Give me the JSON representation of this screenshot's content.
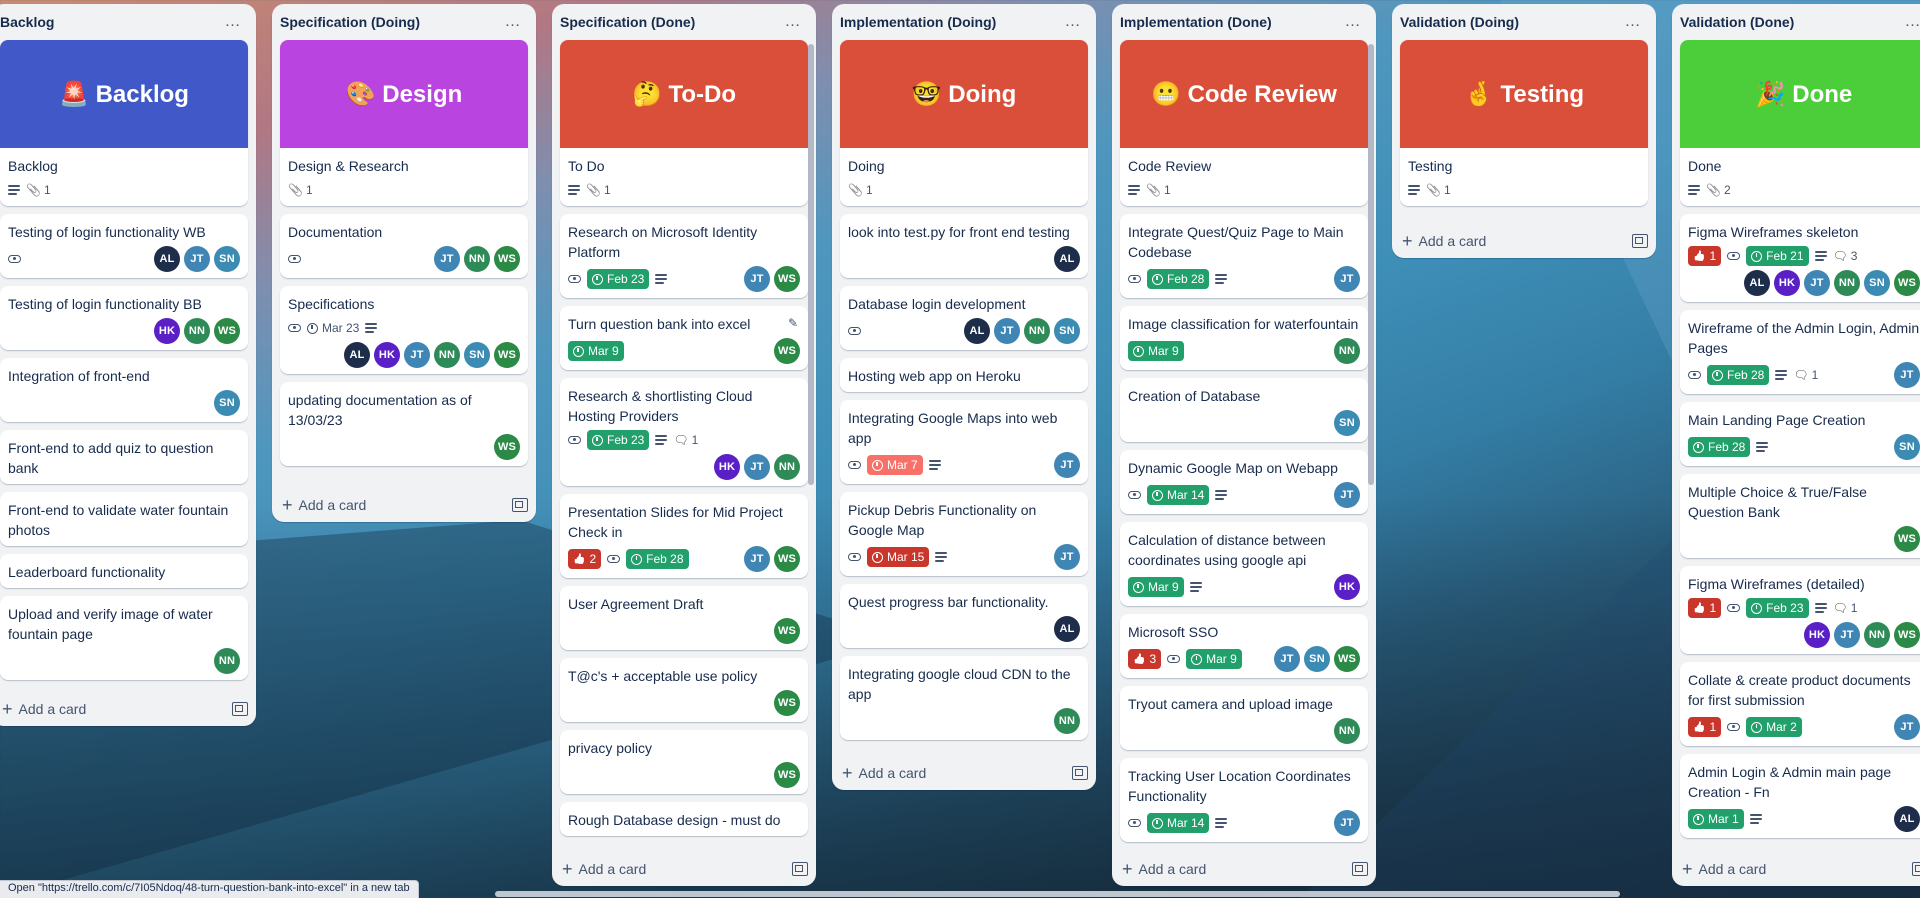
{
  "status_bar": "Open \"https://trello.com/c/7I05Ndoq/48-turn-question-bank-into-excel\" in a new tab",
  "add_card_label": "Add a card",
  "colors": {
    "AL": "#1d2d4a",
    "HK": "#5b1fc6",
    "JT": "#3f86b5",
    "NN": "#2e8b57",
    "SN": "#3b8bb3",
    "WS": "#2b8a45"
  },
  "lists": [
    {
      "title": "Backlog",
      "cards": [
        {
          "cover_color": "#4159c8",
          "cover_text": "🚨 Backlog",
          "title": "Backlog",
          "badges": [
            {
              "type": "desc"
            },
            {
              "type": "attach",
              "text": "1"
            }
          ]
        },
        {
          "title": "Testing of login functionality WB",
          "badges": [
            {
              "type": "watch"
            }
          ],
          "members": [
            "AL",
            "JT",
            "SN"
          ],
          "members_inline": true
        },
        {
          "title": "Testing of login functionality BB",
          "members": [
            "HK",
            "NN",
            "WS"
          ]
        },
        {
          "title": "Integration of front-end",
          "members": [
            "SN"
          ]
        },
        {
          "title": "Front-end to add quiz to question bank"
        },
        {
          "title": "Front-end to validate water fountain photos"
        },
        {
          "title": "Leaderboard functionality"
        },
        {
          "title": "Upload and verify image of water fountain page",
          "members": [
            "NN"
          ]
        }
      ]
    },
    {
      "title": "Specification (Doing)",
      "cards": [
        {
          "cover_color": "#b944e0",
          "cover_text": "🎨 Design",
          "title": "Design & Research",
          "badges": [
            {
              "type": "attach",
              "text": "1"
            }
          ]
        },
        {
          "title": "Documentation",
          "badges": [
            {
              "type": "watch"
            }
          ],
          "members": [
            "JT",
            "NN",
            "WS"
          ],
          "members_inline": true
        },
        {
          "title": "Specifications",
          "badges": [
            {
              "type": "watch"
            },
            {
              "type": "date",
              "style": "plain",
              "text": "Mar 23"
            },
            {
              "type": "desc"
            }
          ],
          "members": [
            "AL",
            "HK",
            "JT",
            "NN",
            "SN",
            "WS"
          ]
        },
        {
          "title": "updating documentation as of 13/03/23",
          "members": [
            "WS"
          ]
        }
      ]
    },
    {
      "title": "Specification (Done)",
      "cards": [
        {
          "cover_color": "#da4f39",
          "cover_text": "🤔 To-Do",
          "title": "To Do",
          "badges": [
            {
              "type": "desc"
            },
            {
              "type": "attach",
              "text": "1"
            }
          ]
        },
        {
          "title": "Research on Microsoft Identity Platform",
          "badges": [
            {
              "type": "watch"
            },
            {
              "type": "date",
              "style": "green",
              "text": "Feb 23"
            },
            {
              "type": "desc"
            }
          ],
          "members": [
            "JT",
            "WS"
          ],
          "members_inline": true
        },
        {
          "title": "Turn question bank into excel",
          "badges": [
            {
              "type": "date",
              "style": "green",
              "text": "Mar 9"
            }
          ],
          "members": [
            "WS"
          ],
          "members_inline": true,
          "pencil": "✎"
        },
        {
          "title": "Research & shortlisting Cloud Hosting Providers",
          "badges": [
            {
              "type": "watch"
            },
            {
              "type": "date",
              "style": "green",
              "text": "Feb 23"
            },
            {
              "type": "desc"
            },
            {
              "type": "comment",
              "text": "1"
            }
          ],
          "members": [
            "HK",
            "JT",
            "NN"
          ]
        },
        {
          "title": "Presentation Slides for Mid Project Check in",
          "badges": [
            {
              "type": "votes",
              "text": "2"
            },
            {
              "type": "watch"
            },
            {
              "type": "date",
              "style": "green",
              "text": "Feb 28"
            }
          ],
          "members": [
            "JT",
            "WS"
          ],
          "members_inline": true
        },
        {
          "title": "User Agreement Draft",
          "members": [
            "WS"
          ]
        },
        {
          "title": "T@c's + acceptable use policy",
          "members": [
            "WS"
          ]
        },
        {
          "title": "privacy policy",
          "members": [
            "WS"
          ]
        },
        {
          "title": "Rough Database design - must do"
        }
      ],
      "scrollbar": true
    },
    {
      "title": "Implementation (Doing)",
      "cards": [
        {
          "cover_color": "#da4f39",
          "cover_text": "🤓 Doing",
          "title": "Doing",
          "badges": [
            {
              "type": "attach",
              "text": "1"
            }
          ]
        },
        {
          "title": "look into test.py for front end testing",
          "members": [
            "AL"
          ]
        },
        {
          "title": "Database login development",
          "badges": [
            {
              "type": "watch"
            }
          ],
          "members": [
            "AL",
            "JT",
            "NN",
            "SN"
          ],
          "members_inline": true
        },
        {
          "title": "Hosting web app on Heroku"
        },
        {
          "title": "Integrating Google Maps into web app",
          "badges": [
            {
              "type": "watch"
            },
            {
              "type": "date",
              "style": "lightred",
              "text": "Mar 7"
            },
            {
              "type": "desc"
            }
          ],
          "members": [
            "JT"
          ],
          "members_inline": true
        },
        {
          "title": "Pickup Debris Functionality on Google Map",
          "badges": [
            {
              "type": "watch"
            },
            {
              "type": "date",
              "style": "red",
              "text": "Mar 15"
            },
            {
              "type": "desc"
            }
          ],
          "members": [
            "JT"
          ],
          "members_inline": true
        },
        {
          "title": "Quest progress bar functionality.",
          "members": [
            "AL"
          ]
        },
        {
          "title": "Integrating google cloud CDN to the app",
          "members": [
            "NN"
          ]
        }
      ]
    },
    {
      "title": "Implementation (Done)",
      "cards": [
        {
          "cover_color": "#da4f39",
          "cover_text": "😬 Code Review",
          "title": "Code Review",
          "badges": [
            {
              "type": "desc"
            },
            {
              "type": "attach",
              "text": "1"
            }
          ]
        },
        {
          "title": "Integrate Quest/Quiz Page to Main Codebase",
          "badges": [
            {
              "type": "watch"
            },
            {
              "type": "date",
              "style": "green",
              "text": "Feb 28"
            },
            {
              "type": "desc"
            }
          ],
          "members": [
            "JT"
          ],
          "members_inline": true
        },
        {
          "title": "Image classification for waterfountain",
          "badges": [
            {
              "type": "date",
              "style": "green",
              "text": "Mar 9"
            }
          ],
          "members": [
            "NN"
          ],
          "members_inline": true
        },
        {
          "title": "Creation of Database",
          "members": [
            "SN"
          ]
        },
        {
          "title": "Dynamic Google Map on Webapp",
          "badges": [
            {
              "type": "watch"
            },
            {
              "type": "date",
              "style": "green",
              "text": "Mar 14"
            },
            {
              "type": "desc"
            }
          ],
          "members": [
            "JT"
          ],
          "members_inline": true
        },
        {
          "title": "Calculation of distance between coordinates using google api",
          "badges": [
            {
              "type": "date",
              "style": "green",
              "text": "Mar 9"
            },
            {
              "type": "desc"
            }
          ],
          "members": [
            "HK"
          ],
          "members_inline": true
        },
        {
          "title": "Microsoft SSO",
          "badges": [
            {
              "type": "votes",
              "text": "3"
            },
            {
              "type": "watch"
            },
            {
              "type": "date",
              "style": "green",
              "text": "Mar 9"
            }
          ],
          "members": [
            "JT",
            "SN",
            "WS"
          ],
          "members_inline": true
        },
        {
          "title": "Tryout camera and upload image",
          "members": [
            "NN"
          ]
        },
        {
          "title": "Tracking User Location Coordinates Functionality",
          "badges": [
            {
              "type": "watch"
            },
            {
              "type": "date",
              "style": "green",
              "text": "Mar 14"
            },
            {
              "type": "desc"
            }
          ],
          "members": [
            "JT"
          ],
          "members_inline": true
        }
      ],
      "scrollbar": true
    },
    {
      "title": "Validation (Doing)",
      "cards": [
        {
          "cover_color": "#da4f39",
          "cover_text": "🤞 Testing",
          "title": "Testing",
          "badges": [
            {
              "type": "desc"
            },
            {
              "type": "attach",
              "text": "1"
            }
          ]
        }
      ]
    },
    {
      "title": "Validation (Done)",
      "cards": [
        {
          "cover_color": "#4bce3a",
          "cover_text": "🎉 Done",
          "title": "Done",
          "badges": [
            {
              "type": "desc"
            },
            {
              "type": "attach",
              "text": "2"
            }
          ]
        },
        {
          "title": "Figma Wireframes skeleton",
          "badges": [
            {
              "type": "votes",
              "text": "1"
            },
            {
              "type": "watch"
            },
            {
              "type": "date",
              "style": "green",
              "text": "Feb 21"
            },
            {
              "type": "desc"
            },
            {
              "type": "comment",
              "text": "3"
            }
          ],
          "members": [
            "AL",
            "HK",
            "JT",
            "NN",
            "SN",
            "WS"
          ]
        },
        {
          "title": "Wireframe of the Admin Login, Admin Pages",
          "badges": [
            {
              "type": "watch"
            },
            {
              "type": "date",
              "style": "green",
              "text": "Feb 28"
            },
            {
              "type": "desc"
            },
            {
              "type": "comment",
              "text": "1"
            }
          ],
          "members": [
            "JT"
          ],
          "members_inline": true
        },
        {
          "title": "Main Landing Page Creation",
          "badges": [
            {
              "type": "date",
              "style": "green",
              "text": "Feb 28"
            },
            {
              "type": "desc"
            }
          ],
          "members": [
            "SN"
          ],
          "members_inline": true
        },
        {
          "title": "Multiple Choice & True/False Question Bank",
          "members": [
            "WS"
          ]
        },
        {
          "title": "Figma Wireframes (detailed)",
          "badges": [
            {
              "type": "votes",
              "text": "1"
            },
            {
              "type": "watch"
            },
            {
              "type": "date",
              "style": "green",
              "text": "Feb 23"
            },
            {
              "type": "desc"
            },
            {
              "type": "comment",
              "text": "1"
            }
          ],
          "members": [
            "HK",
            "JT",
            "NN",
            "WS"
          ]
        },
        {
          "title": "Collate & create product documents for first submission",
          "badges": [
            {
              "type": "votes",
              "text": "1"
            },
            {
              "type": "watch"
            },
            {
              "type": "date",
              "style": "green",
              "text": "Mar 2"
            }
          ],
          "members": [
            "JT"
          ],
          "members_inline": true
        },
        {
          "title": "Admin Login & Admin main page Creation - Fn",
          "badges": [
            {
              "type": "date",
              "style": "green",
              "text": "Mar 1"
            },
            {
              "type": "desc"
            }
          ],
          "members": [
            "AL"
          ],
          "members_inline": true
        }
      ]
    }
  ]
}
